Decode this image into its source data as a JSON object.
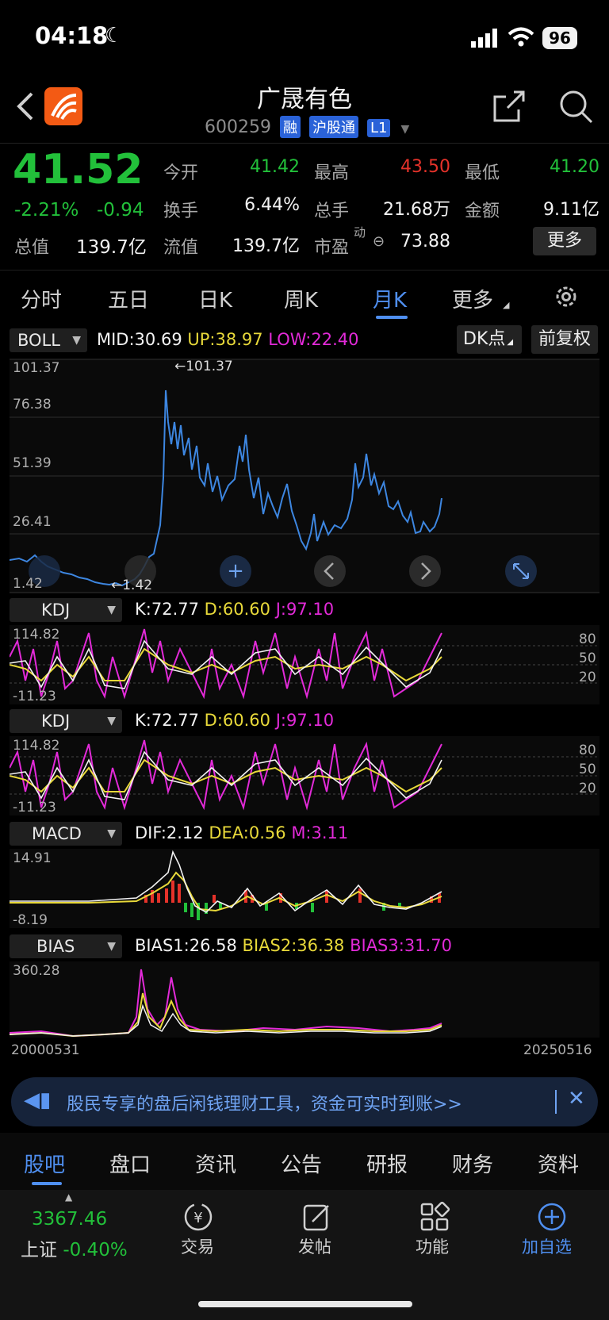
{
  "status": {
    "time": "04:18",
    "battery": "96"
  },
  "header": {
    "title": "广晟有色",
    "code": "600259",
    "badges": [
      "融",
      "沪股通",
      "L1"
    ]
  },
  "quote": {
    "price": "41.52",
    "change_pct": "-2.21%",
    "change": "-0.94",
    "open_label": "今开",
    "open": "41.42",
    "high_label": "最高",
    "high": "43.50",
    "low_label": "最低",
    "low": "41.20",
    "turnover_label": "换手",
    "turnover": "6.44%",
    "volume_label": "总手",
    "volume": "21.68万",
    "amount_label": "金额",
    "amount": "9.11亿",
    "mcap_label": "总值",
    "mcap": "139.7亿",
    "float_label": "流值",
    "float": "139.7亿",
    "pe_label": "市盈",
    "pe_sup": "动",
    "pe": "73.88",
    "more_button": "更多"
  },
  "tabs": [
    "分时",
    "五日",
    "日K",
    "周K",
    "月K",
    "更多"
  ],
  "boll": {
    "selector": "BOLL",
    "mid": "MID:30.69",
    "up": "UP:38.97",
    "low": "LOW:22.40",
    "dk_button": "DK点",
    "fq_button": "前复权",
    "y_ticks": [
      "101.37",
      "76.38",
      "51.39",
      "26.41",
      "1.42"
    ],
    "max_label": "←101.37",
    "min_label": "←1.42"
  },
  "kdj1": {
    "selector": "KDJ",
    "k": "K:72.77",
    "d": "D:60.60",
    "j": "J:97.10",
    "y_top": "114.82",
    "y_bottom": "-11.23",
    "levels": [
      "80",
      "50",
      "20"
    ]
  },
  "kdj2": {
    "selector": "KDJ",
    "k": "K:72.77",
    "d": "D:60.60",
    "j": "J:97.10",
    "y_top": "114.82",
    "y_bottom": "-11.23",
    "levels": [
      "80",
      "50",
      "20"
    ]
  },
  "macd": {
    "selector": "MACD",
    "dif": "DIF:2.12",
    "dea": "DEA:0.56",
    "m": "M:3.11",
    "y_top": "14.91",
    "y_bottom": "-8.19"
  },
  "bias": {
    "selector": "BIAS",
    "b1": "BIAS1:26.58",
    "b2": "BIAS2:36.38",
    "b3": "BIAS3:31.70",
    "y_top": "360.28",
    "date_start": "20000531",
    "date_end": "20250516"
  },
  "promo": {
    "text": "股民专享的盘后闲钱理财工具，资金可实时到账>>"
  },
  "bottom_tabs": [
    "股吧",
    "盘口",
    "资讯",
    "公告",
    "研报",
    "财务",
    "资料"
  ],
  "bottom_nav": {
    "index_value": "3367.46",
    "index_name": "上证",
    "index_change": "-0.40%",
    "trade": "交易",
    "post": "发帖",
    "func": "功能",
    "add": "加自选"
  },
  "colors": {
    "up": "#e5322a",
    "down": "#22c03a",
    "accent": "#2a62d8",
    "price_line": "#3d86e0"
  }
}
